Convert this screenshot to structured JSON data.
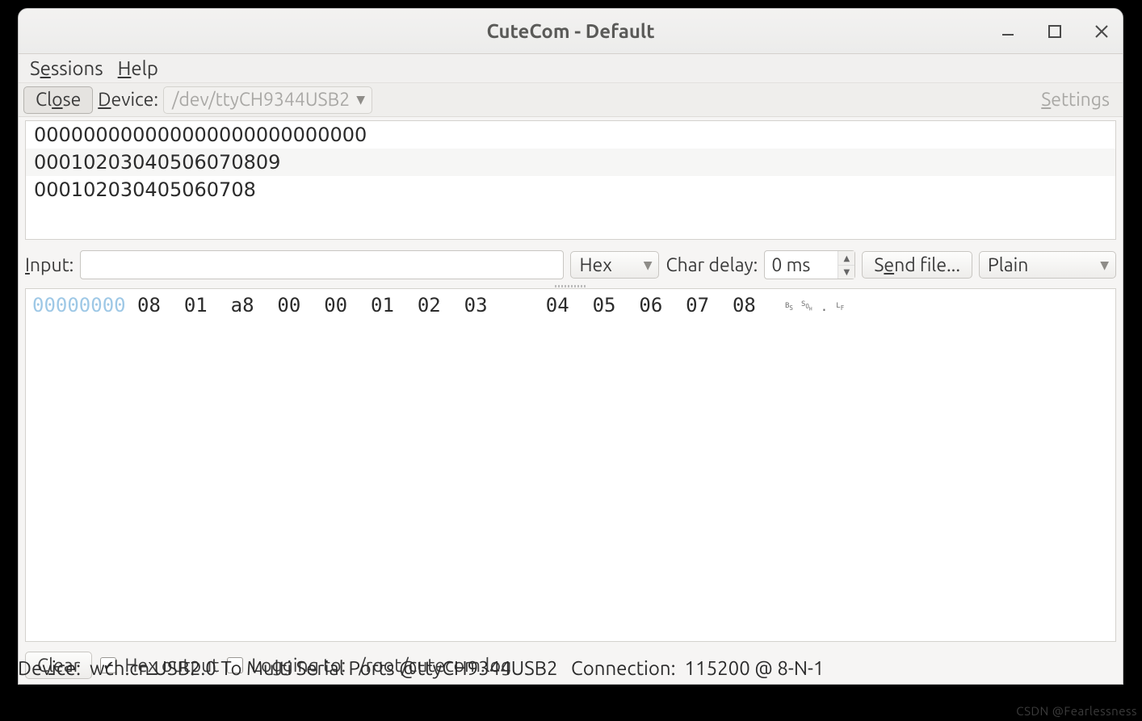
{
  "window": {
    "title": "CuteCom - Default"
  },
  "menu": {
    "sessions": "Sessions",
    "help": "Help"
  },
  "toolbar": {
    "close_label": "Close",
    "device_label": "Device:",
    "device_value": "/dev/ttyCH9344USB2",
    "settings_label": "Settings"
  },
  "received": {
    "lines": [
      "000000000000000000000000000",
      "00010203040506070809",
      "000102030405060708"
    ]
  },
  "input": {
    "label": "Input:",
    "value": "",
    "format": "Hex",
    "chardelay_label": "Char delay:",
    "chardelay_value": "0 ms",
    "sendfile_label": "Send file...",
    "sendmode": "Plain"
  },
  "hexview": {
    "addr": "00000000",
    "bytes_a": " 08  01  a8  00  00  01  02  03",
    "bytes_b": "04  05  06  07  08",
    "ctrl": [
      "Bs",
      "SoH",
      ".",
      "LF"
    ]
  },
  "bottom": {
    "clear_label": "Clear",
    "hexoutput_label": "Hex output",
    "hex_checked": true,
    "logging_label": "Logging to:",
    "logging_checked": false,
    "logpath": "/root/cutecom.log"
  },
  "status": {
    "device_label": "Device:",
    "device_value": "wch.cn USB2.0 To Multi Serial Ports @ttyCH9344USB2",
    "connection_label": "Connection:",
    "connection_value": "115200 @ 8-N-1"
  },
  "watermark": "CSDN @Fearlessness"
}
